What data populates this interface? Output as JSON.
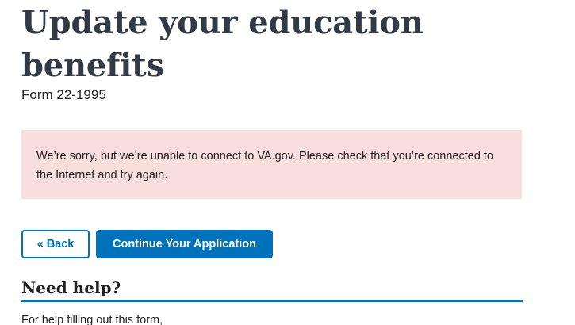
{
  "header": {
    "title": "Update your education benefits",
    "form_number": "Form 22-1995"
  },
  "alert": {
    "message": "We’re sorry, but we’re unable to connect to VA.gov. Please check that you’re connected to the Internet and try again.",
    "background_color": "#f9dede"
  },
  "actions": {
    "back_label": "« Back",
    "continue_label": "Continue Your Application",
    "primary_color": "#0071bb"
  },
  "help": {
    "heading": "Need help?",
    "text": "For help filling out this form,"
  }
}
